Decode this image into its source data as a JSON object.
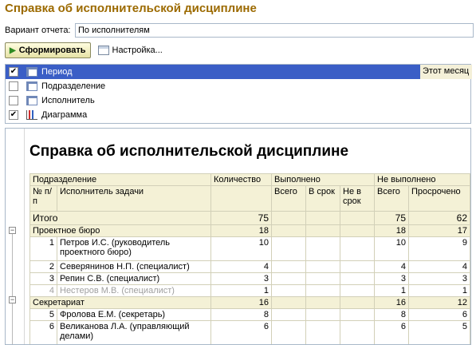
{
  "title": "Справка об исполнительской дисциплине",
  "variant": {
    "label": "Вариант отчета:",
    "value": "По исполнителям"
  },
  "toolbar": {
    "generate_label": "Сформировать",
    "settings_label": "Настройка..."
  },
  "params": [
    {
      "label": "Период",
      "checked": "✔",
      "value": "Этот месяц",
      "icon": "table-icon"
    },
    {
      "label": "Подразделение",
      "checked": "",
      "icon": "table-icon"
    },
    {
      "label": "Исполнитель",
      "checked": "",
      "icon": "table-icon"
    },
    {
      "label": "Диаграмма",
      "checked": "✔",
      "icon": "chart-icon"
    }
  ],
  "report": {
    "title": "Справка об исполнительской дисциплине",
    "headers": {
      "department": "Подразделение",
      "count": "Количество",
      "done": "Выполнено",
      "not_done": "Не выполнено",
      "num": "№ п/п",
      "executor": "Исполнитель задачи",
      "total": "Всего",
      "on_time": "В срок",
      "late": "Не в срок",
      "total2": "Всего",
      "overdue": "Просрочено"
    },
    "totals": {
      "label": "Итого",
      "count": "75",
      "nd_total": "75",
      "overdue": "62"
    },
    "groups": [
      {
        "name": "Проектное бюро",
        "count": "18",
        "nd_total": "18",
        "overdue": "17",
        "rows": [
          {
            "n": "1",
            "name": "Петров И.С. (руководитель проектного бюро)",
            "count": "10",
            "nd_total": "10",
            "overdue": "9"
          },
          {
            "n": "2",
            "name": "Северянинов Н.П. (специалист)",
            "count": "4",
            "nd_total": "4",
            "overdue": "4"
          },
          {
            "n": "3",
            "name": "Репин С.В. (специалист)",
            "count": "3",
            "nd_total": "3",
            "overdue": "3"
          },
          {
            "n": "4",
            "name": "Нестеров М.В. (специалист)",
            "count": "1",
            "nd_total": "1",
            "overdue": "1"
          }
        ]
      },
      {
        "name": "Секретариат",
        "count": "16",
        "nd_total": "16",
        "overdue": "12",
        "rows": [
          {
            "n": "5",
            "name": "Фролова Е.М. (секретарь)",
            "count": "8",
            "nd_total": "8",
            "overdue": "6"
          },
          {
            "n": "6",
            "name": "Великанова Л.А. (управляющий делами)",
            "count": "6",
            "nd_total": "6",
            "overdue": "5"
          }
        ]
      }
    ]
  }
}
